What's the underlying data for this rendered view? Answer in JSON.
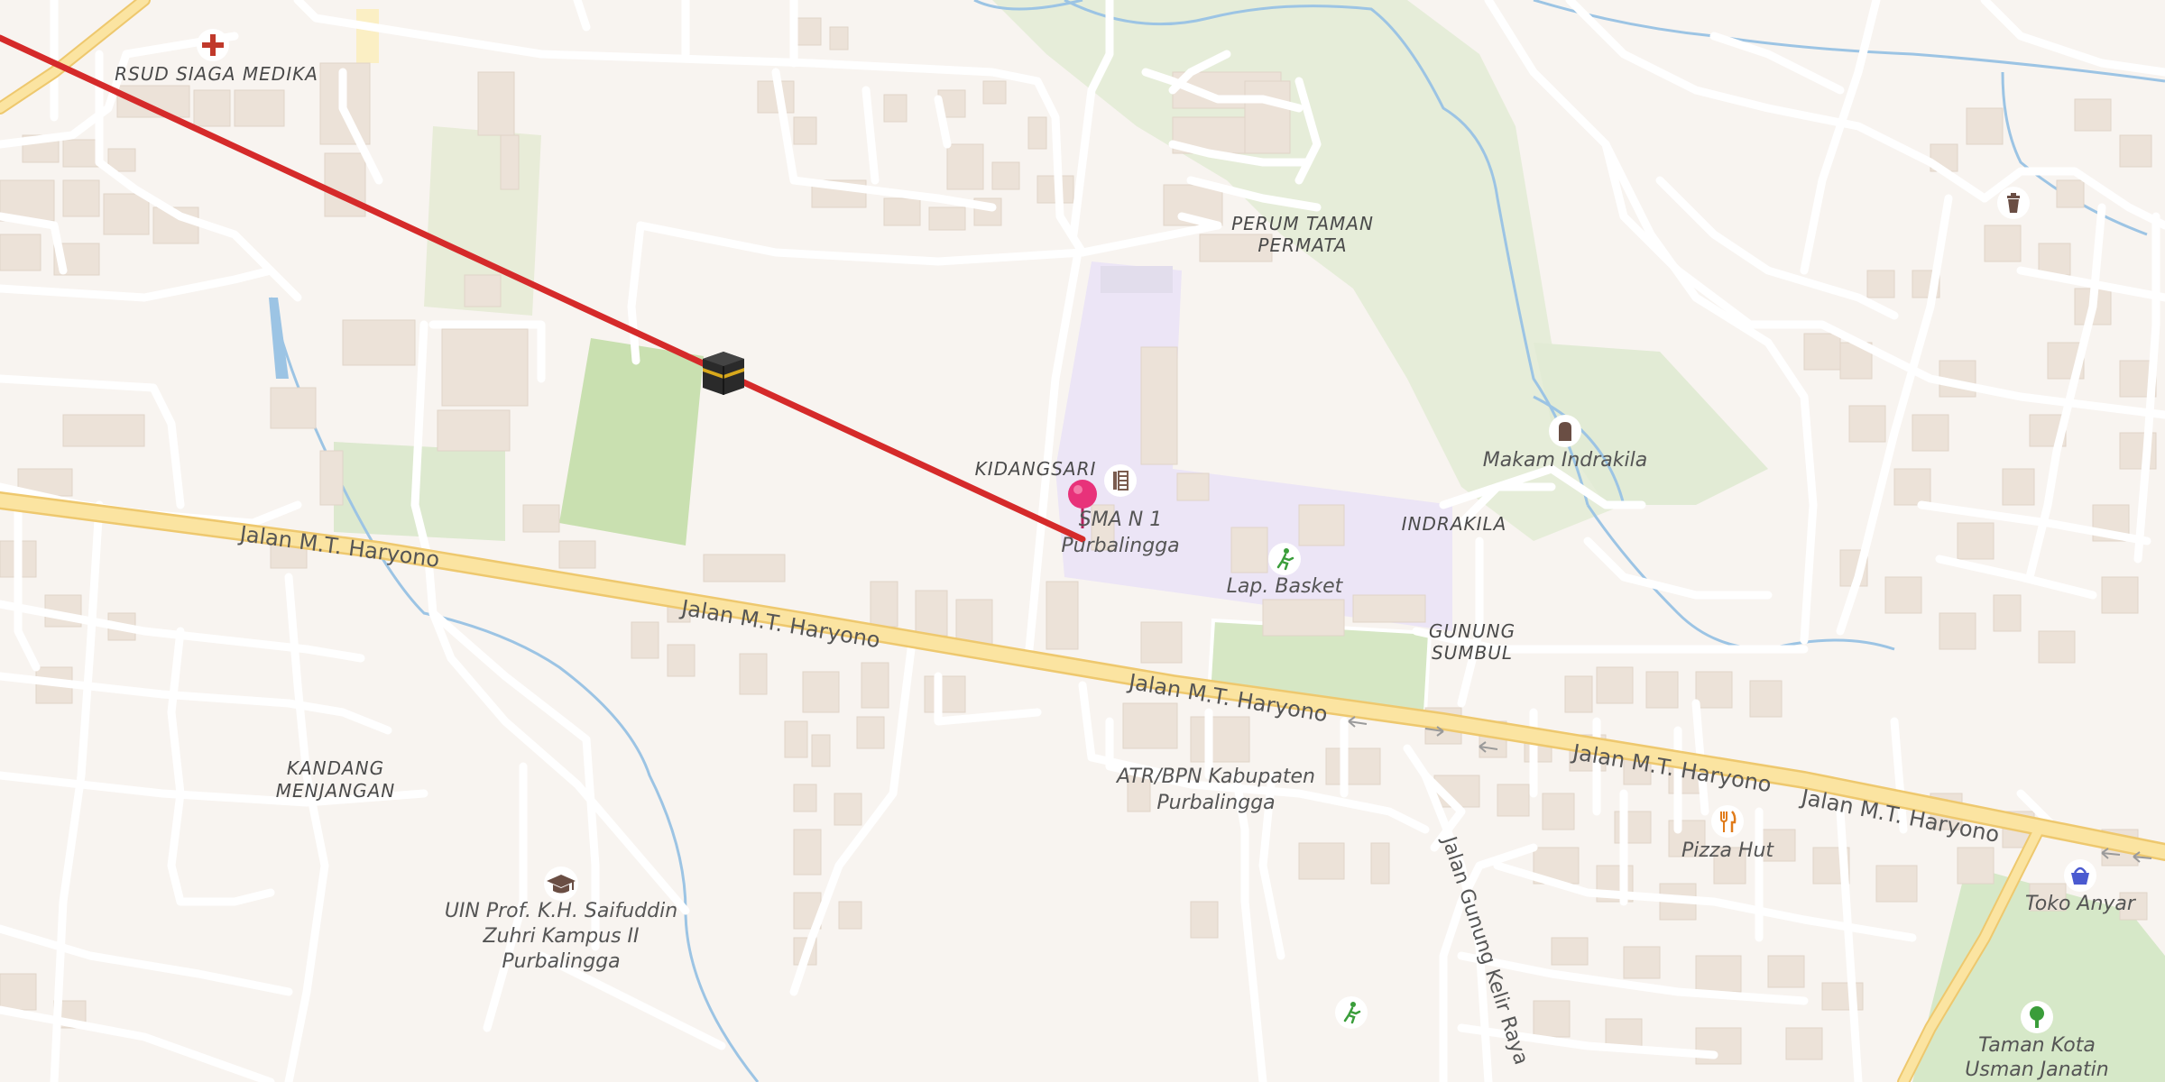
{
  "colors": {
    "background": "#f8f4f0",
    "building": "#ece2d8",
    "minor_road": "#ffffff",
    "major_road": "#fbe4a1",
    "major_road_casing": "#eec86e",
    "park": "#dce9cf",
    "pitch": "#c8e0b0",
    "school": "#ece5f6",
    "water": "#9cc4e4",
    "route_line": "#d52a2a",
    "pin": "#e8327a",
    "poi_icon": "#7a5c4f"
  },
  "places": {
    "rsud": "RSUD SIAGA MEDIKA",
    "perum_taman_1": "PERUM TAMAN",
    "perum_taman_2": "PERMATA",
    "kidangsari": "KIDANGSARI",
    "indrakila": "INDRAKILA",
    "gunung_1": "GUNUNG",
    "gunung_2": "SUMBUL",
    "kandang_1": "KANDANG",
    "kandang_2": "MENJANGAN"
  },
  "pois": {
    "sma_1": "SMA N 1",
    "sma_2": "Purbalingga",
    "lap_basket": "Lap. Basket",
    "makam": "Makam Indrakila",
    "atr_1": "ATR/BPN Kabupaten",
    "atr_2": "Purbalingga",
    "pizza": "Pizza Hut",
    "toko": "Toko Anyar",
    "uin_1": "UIN Prof. K.H. Saifuddin",
    "uin_2": "Zuhri Kampus II",
    "uin_3": "Purbalingga",
    "taman_1": "Taman Kota",
    "taman_2": "Usman Janatin"
  },
  "roads": {
    "haryono": "Jalan M.T. Haryono",
    "gunung_kelir": "Jalan Gunung Kelir Raya"
  },
  "icons": {
    "hospital": "hospital-cross-icon",
    "kaaba": "kaaba-icon",
    "location_pin": "location-pin-icon",
    "school": "school-icon",
    "sports": "sports-pitch-icon",
    "cemetery": "cemetery-icon",
    "waste": "waste-basket-icon",
    "restaurant": "restaurant-icon",
    "shop": "shopping-basket-icon",
    "university": "university-cap-icon",
    "park": "park-tree-icon"
  }
}
